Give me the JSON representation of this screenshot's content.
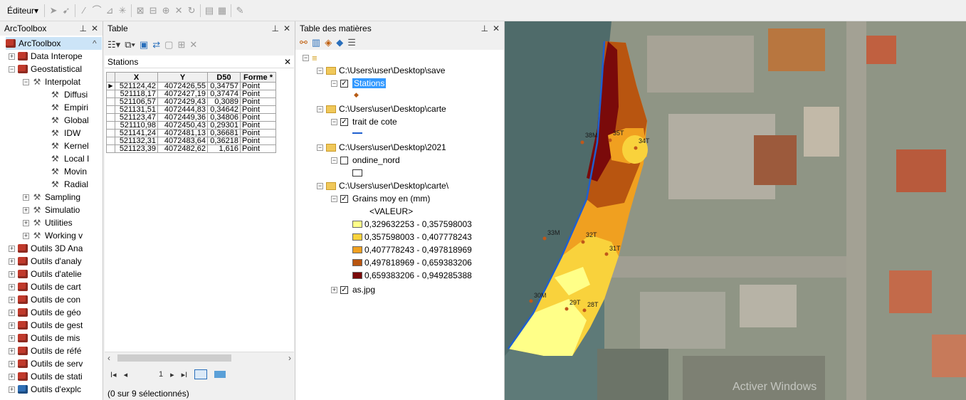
{
  "toolbar": {
    "editor_label": "Éditeur"
  },
  "arctoolbox": {
    "title": "ArcToolbox",
    "root": "ArcToolbox",
    "items": [
      {
        "label": "Data Interope"
      },
      {
        "label": "Geostatistical"
      },
      {
        "label": "Interpolat"
      },
      {
        "label": "Diffusi"
      },
      {
        "label": "Empiri"
      },
      {
        "label": "Global"
      },
      {
        "label": "IDW"
      },
      {
        "label": "Kernel"
      },
      {
        "label": "Local I"
      },
      {
        "label": "Movin"
      },
      {
        "label": "Radial"
      },
      {
        "label": "Sampling"
      },
      {
        "label": "Simulatio"
      },
      {
        "label": "Utilities"
      },
      {
        "label": "Working v"
      },
      {
        "label": "Outils 3D Ana"
      },
      {
        "label": "Outils d'analy"
      },
      {
        "label": "Outils d'atelie"
      },
      {
        "label": "Outils de cart"
      },
      {
        "label": "Outils de con"
      },
      {
        "label": "Outils de géo"
      },
      {
        "label": "Outils de gest"
      },
      {
        "label": "Outils de mis"
      },
      {
        "label": "Outils de réfé"
      },
      {
        "label": "Outils de serv"
      },
      {
        "label": "Outils de stati"
      },
      {
        "label": "Outils d'explc"
      }
    ]
  },
  "table": {
    "title": "Table",
    "layer_tab": "Stations",
    "columns": [
      "X",
      "Y",
      "D50",
      "Forme *"
    ],
    "rows": [
      [
        "521124,42",
        "4072426,55",
        "0,34757",
        "Point"
      ],
      [
        "521118,17",
        "4072427,19",
        "0,37474",
        "Point"
      ],
      [
        "521106,57",
        "4072429,43",
        "0,3089",
        "Point"
      ],
      [
        "521131,51",
        "4072444,83",
        "0,34642",
        "Point"
      ],
      [
        "521123,47",
        "4072449,36",
        "0,34806",
        "Point"
      ],
      [
        "521110,98",
        "4072450,43",
        "0,29301",
        "Point"
      ],
      [
        "521141,24",
        "4072481,13",
        "0,36681",
        "Point"
      ],
      [
        "521132,31",
        "4072483,64",
        "0,36218",
        "Point"
      ],
      [
        "521123,39",
        "4072482,62",
        "1,616",
        "Point"
      ]
    ],
    "page_number": "1",
    "status": "(0 sur 9 sélectionnés)"
  },
  "toc": {
    "title": "Table des matières",
    "group1_path": "C:\\Users\\user\\Desktop\\save",
    "layer_stations": "Stations",
    "group2_path": "C:\\Users\\user\\Desktop\\carte",
    "layer_trait": "trait de cote",
    "group3_path": "C:\\Users\\user\\Desktop\\2021",
    "layer_ondine": "ondine_nord",
    "group4_path": "C:\\Users\\user\\Desktop\\carte\\",
    "layer_grains": "Grains moy en (mm)",
    "valeur_header": "<VALEUR>",
    "classes": [
      {
        "label": "0,329632253 - 0,357598003",
        "color": "#ffff88"
      },
      {
        "label": "0,357598003 - 0,407778243",
        "color": "#f9d23c"
      },
      {
        "label": "0,407778243 - 0,497818969",
        "color": "#f0a020"
      },
      {
        "label": "0,497818969 - 0,659383206",
        "color": "#b85510"
      },
      {
        "label": "0,659383206 - 0,949285388",
        "color": "#7a0a0a"
      }
    ],
    "layer_jpg": "as.jpg"
  },
  "map": {
    "stations": [
      "38M",
      "35T",
      "34T",
      "33M",
      "32T",
      "31T",
      "30M",
      "29T",
      "28T"
    ],
    "watermark": "Activer Windows"
  }
}
